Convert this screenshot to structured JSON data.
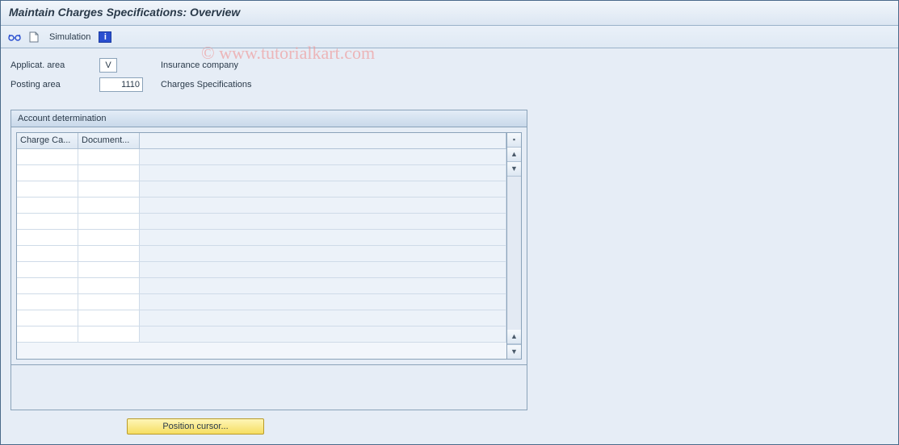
{
  "title": "Maintain Charges Specifications: Overview",
  "toolbar": {
    "simulation_label": "Simulation"
  },
  "fields": {
    "applicat_area": {
      "label": "Applicat. area",
      "value": "V",
      "desc": "Insurance company"
    },
    "posting_area": {
      "label": "Posting area",
      "value": "1110",
      "desc": "Charges Specifications"
    }
  },
  "panel": {
    "title": "Account determination",
    "columns": {
      "c1": "Charge Ca...",
      "c2": "Document..."
    },
    "row_count": 12
  },
  "buttons": {
    "position_cursor": "Position cursor..."
  },
  "watermark": "© www.tutorialkart.com"
}
